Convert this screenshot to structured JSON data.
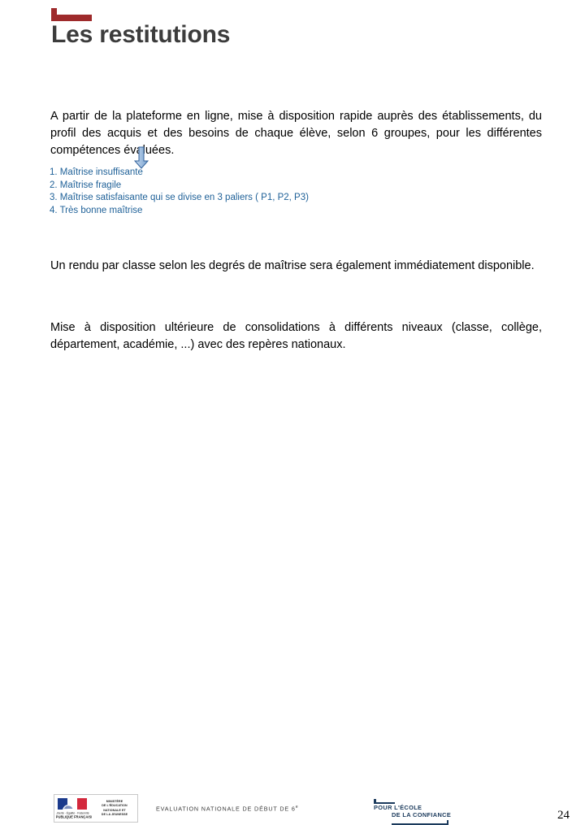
{
  "slide": {
    "title": "Les restitutions",
    "title_mark_color": "#9E2A2B",
    "title_color": "#3C3C3C",
    "background_color": "#FFFFFF"
  },
  "body": {
    "paragraph_1": "A partir de la plateforme en ligne, mise à disposition rapide auprès des établissements, du profil des acquis et des besoins de chaque élève, selon 6 groupes, pour les différentes compétences évaluées.",
    "paragraph_2": "Un rendu par classe selon les degrés de maîtrise sera également immédiatement disponible.",
    "paragraph_3": "Mise à disposition ultérieure de consolidations à différents niveaux (classe, collège, département, académie, ...) avec des repères nationaux."
  },
  "arrow": {
    "icon": "down-arrow-icon",
    "fill_light": "#AFC9E6",
    "fill_dark": "#6A96C8",
    "stroke": "#31619B"
  },
  "degree_levels": {
    "color": "#1F6198",
    "items": [
      "1. Maîtrise insuffisante",
      "2. Maîtrise fragile",
      "3. Maîtrise satisfaisante qui se divise en 3 paliers ( P1, P2, P3)",
      "4. Très bonne maîtrise"
    ]
  },
  "footer": {
    "republic_logo": {
      "icon": "marianne-flag-icon",
      "motto_line_1": "Liberté  Égalité  Fraternité",
      "motto_line_2": "République Française",
      "ministry_line_1": "MINISTÈRE",
      "ministry_line_2": "DE L'ÉDUCATION",
      "ministry_line_3": "NATIONALE ET",
      "ministry_line_4": "DE LA JEUNESSE"
    },
    "evaluation_label": "EVALUATION NATIONALE DE DÉBUT DE 6",
    "evaluation_label_sup": "e",
    "confiance_logo": {
      "line_1": "POUR L'ÉCOLE",
      "line_2": "DE LA CONFIANCE",
      "color": "#1B3A5C"
    },
    "page_number": "24"
  }
}
